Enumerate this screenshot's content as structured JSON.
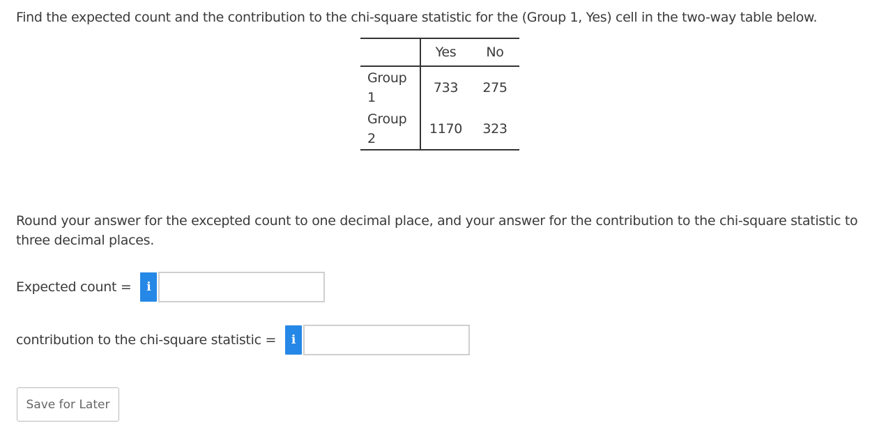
{
  "question": {
    "text": "Find the expected count and the contribution to the chi-square statistic for the (Group 1, Yes) cell in the two-way table below."
  },
  "table": {
    "columns": [
      "Yes",
      "No"
    ],
    "rows": [
      {
        "label_line1": "Group",
        "label_line2": "1",
        "values": [
          "733",
          "275"
        ]
      },
      {
        "label_line1": "Group",
        "label_line2": "2",
        "values": [
          "1170",
          "323"
        ]
      }
    ]
  },
  "instructions": "Round your answer for the excepted count to one decimal place, and your answer for the contribution to the chi-square statistic to three decimal places.",
  "fields": [
    {
      "label": "Expected count =",
      "info_icon": "i",
      "value": ""
    },
    {
      "label": "contribution to the chi-square statistic =",
      "info_icon": "i",
      "value": ""
    }
  ],
  "save_button": {
    "label": "Save for Later"
  },
  "colors": {
    "info_button": "#2688e6",
    "input_border": "#cfcfcf",
    "text": "#3a3a3a"
  }
}
